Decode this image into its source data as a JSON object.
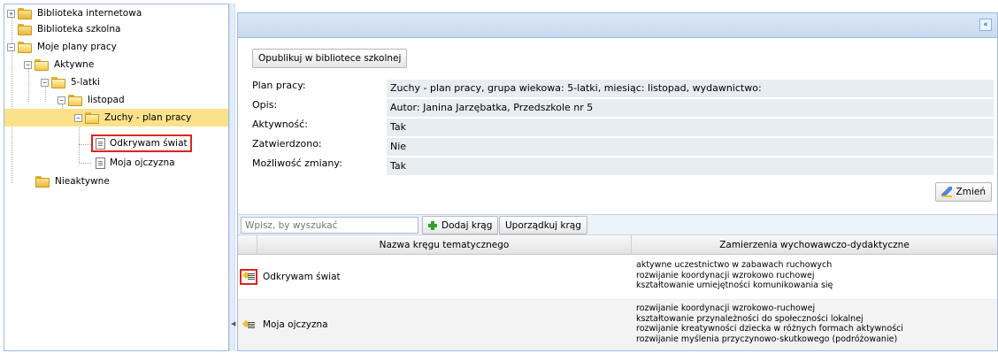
{
  "tree": {
    "nodes": [
      {
        "label": "Biblioteka internetowa",
        "expander": "+"
      },
      {
        "label": "Biblioteka szkolna"
      },
      {
        "label": "Moje plany pracy",
        "expander": "−"
      },
      {
        "label": "Aktywne",
        "expander": "−"
      },
      {
        "label": "5-latki",
        "expander": "−"
      },
      {
        "label": "listopad",
        "expander": "−"
      },
      {
        "label": "Zuchy - plan pracy",
        "expander": "−"
      },
      {
        "label": "Odkrywam świat"
      },
      {
        "label": "Moja ojczyzna"
      },
      {
        "label": "Nieaktywne"
      }
    ]
  },
  "panel": {
    "collapse_glyph": "«",
    "publish_button": "Opublikuj w bibliotece szkolnej",
    "properties": [
      {
        "label": "Plan pracy:",
        "value": "Zuchy - plan pracy, grupa wiekowa: 5-latki, miesiąc: listopad, wydawnictwo:"
      },
      {
        "label": "Opis:",
        "value": "Autor: Janina Jarzębatka, Przedszkole nr 5"
      },
      {
        "label": "Aktywność:",
        "value": "Tak"
      },
      {
        "label": "Zatwierdzono:",
        "value": "Nie"
      },
      {
        "label": "Możliwość zmiany:",
        "value": "Tak"
      }
    ],
    "edit_button": "Zmień"
  },
  "grid": {
    "search_placeholder": "Wpisz, by wyszukać",
    "add_button": "Dodaj krąg",
    "sort_button": "Uporządkuj krąg",
    "columns": [
      "Nazwa kręgu tematycznego",
      "Zamierzenia wychowawczo-dydaktyczne"
    ],
    "rows": [
      {
        "name": "Odkrywam świat",
        "goals": [
          "aktywne uczestnictwo w zabawach ruchowych",
          "rozwijanie koordynacji wzrokowo ruchowej",
          "kształtowanie umiejętności komunikowania się"
        ]
      },
      {
        "name": "Moja ojczyzna",
        "goals": [
          "rozwijanie koordynacji wzrokowo-ruchowej",
          "kształtowanie przynależności do społeczności lokalnej",
          "rozwijanie kreatywności dziecka w różnych formach aktywności",
          "rozwijanie myślenia przyczynowo-skutkowego (podróżowanie)"
        ]
      }
    ]
  }
}
